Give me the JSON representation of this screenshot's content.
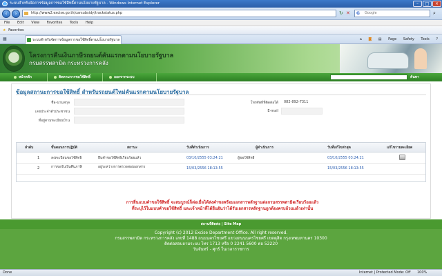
{
  "window": {
    "title": "ระบบสำหรับจัดการข้อมูลการขอใช้สิทธิ์ตามนโยบายรัฐบาล - Windows Internet Explorer",
    "url": "http://www2.excise.go.th/carsubsidy/trackstatus.php",
    "search_placeholder": "Google",
    "menu": [
      "File",
      "Edit",
      "View",
      "Favorites",
      "Tools",
      "Help"
    ],
    "favorites_label": "Favorites",
    "tab_label": "ระบบสำหรับจัดการข้อมูลการขอใช้สิทธิ์ตามนโยบายรัฐบาล",
    "commands": [
      "Page",
      "Safety",
      "Tools"
    ],
    "status_text": "Done",
    "status_zone": "Internet | Protected Mode: Off",
    "status_zoom": "100%"
  },
  "site": {
    "title": "โครงการคืนเงินภาษีรถยนต์คันแรกตามนโยบายรัฐบาล",
    "subtitle": "กรมสรรพสามิต กระทรวงการคลัง",
    "nav": [
      "หน้าหลัก",
      "ติดตามการขอใช้สิทธิ์",
      "ออกจากระบบ"
    ],
    "nav_search_button": "ค้นหา"
  },
  "status": {
    "section_title": "ข้อมูลสถานะการขอใช้สิทธิ์ สำหรับรถยนต์ใหม่คันแรกตามนโยบายรัฐบาล",
    "fields": {
      "name_label": "ชื่อ-นามสกุล",
      "name_value": "",
      "id_label": "เลขประจำตัวประชาชน",
      "id_value": "",
      "address_label": "ที่อยู่ตามทะเบียนบ้าน",
      "address_value": "",
      "phone_label": "โทรศัพท์ที่ติดต่อได้",
      "phone_value": "082-892-7311",
      "email_label": "E-mail",
      "email_value": ""
    },
    "table": {
      "headers": [
        "ลำดับ",
        "ขั้นตอนการปฏิบัติ",
        "สถานะ",
        "วันที่ดำเนินการ",
        "ผู้ดำเนินการ",
        "วันที่แก้ไขล่าสุด",
        "แก้ไขรายละเอียด"
      ],
      "rows": [
        {
          "no": "1",
          "step": "ลงทะเบียนขอใช้สิทธิ์",
          "status": "ยื่นคำขอใช้สิทธิ์เรียบร้อยแล้ว",
          "date": "03/10/2555 03:24:21",
          "by": "ผู้ขอใช้สิทธิ์",
          "updated": "03/10/2555 03:24:21"
        },
        {
          "no": "2",
          "step": "การขอรับเงินคืนภาษี",
          "status": "อยู่ระหว่างการตรวจสอบเอกสาร",
          "date": "15/03/2556 18:13:55",
          "by": "",
          "updated": "15/03/2556 18:13:55"
        }
      ]
    },
    "notice_line1": "การยื่นแบบคำขอใช้สิทธิ์ จะสมบูรณ์ก็ต่อเมื่อได้ส่งคำขอพร้อมเอกสารหลักฐานต่อกรมสรรพสามิตเรียบร้อยแล้ว",
    "notice_line2": "ที่ระบุไว้ในแบบคำขอใช้สิทธิ์ และเจ้าหน้าที่ได้ยืนยันว่าได้รับเอกสารหลักฐานถูกต้องครบถ้วนแล้วเท่านั้น"
  },
  "footer": {
    "links": "สถานที่ติดต่อ | Site Map",
    "copyright": "Copyright (c) 2012 Excise Department Office. All right reserved.",
    "address": "กรมสรรพสามิต กระทรวงการคลัง เลขที่ 1488 ถนนนครไชยศรี แขวงถนนนครไชยศรี เขตดุสิต กรุงเทพมหานคร 10300",
    "contact": "ติดต่อสอบถามระบบ โทร 1713 หรือ 0 2241 5600 ต่อ 52220",
    "hours": "วันจันทร์ - ศุกร์ ในเวลาราชการ"
  }
}
